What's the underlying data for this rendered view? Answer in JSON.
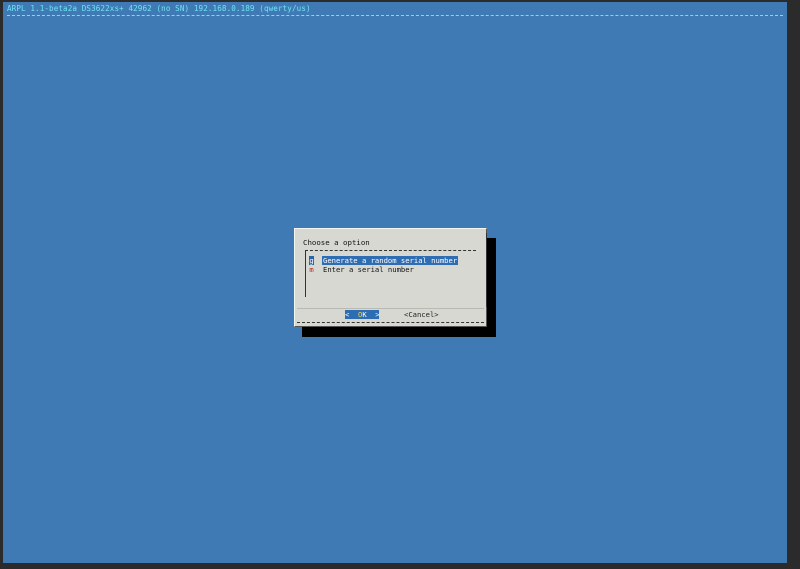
{
  "backtitle": "ARPL 1.1-beta2a DS3622xs+ 42962 (no SN) 192.168.0.189 (qwerty/us)",
  "dialog": {
    "title": "Choose a option",
    "items": [
      {
        "tag": "g",
        "label": "Generate a random serial number",
        "selected": true
      },
      {
        "tag": "m",
        "label": "Enter a serial number",
        "selected": false
      }
    ],
    "buttons": {
      "ok_left": "<",
      "ok_hot": "O",
      "ok_rest": "K",
      "ok_right": ">",
      "cancel": "<Cancel>"
    }
  },
  "colors": {
    "screen_bg": "#3f7ab5",
    "backtitle_fg": "#6fe3f2",
    "dialog_bg": "#d8d8d2",
    "selection_bg": "#2f6db3",
    "tag_fg": "#b22a24",
    "hotkey_fg": "#f3d13a"
  }
}
